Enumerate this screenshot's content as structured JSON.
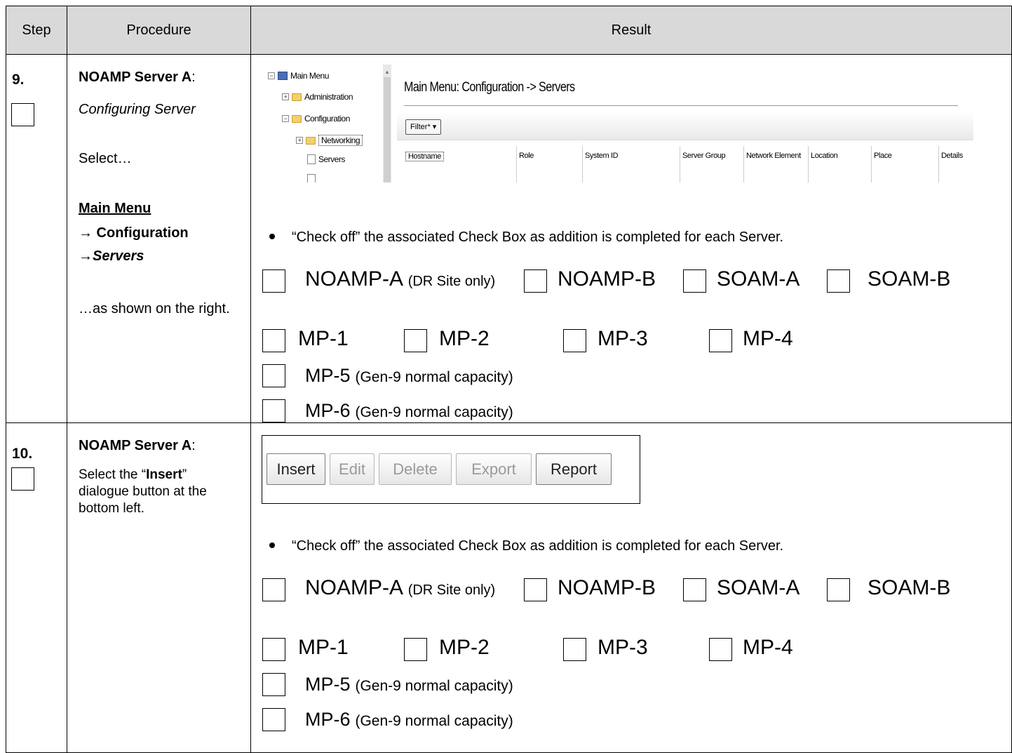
{
  "headers": {
    "step": "Step",
    "procedure": "Procedure",
    "result": "Result"
  },
  "step9": {
    "number": "9.",
    "title": "NOAMP Server A",
    "title_suffix": ":",
    "subtitle": "Configuring Server",
    "select": "Select…",
    "menu1": "Main Menu",
    "menu2": "→ Configuration",
    "menu3": "→Servers",
    "shown": "…as shown on the right.",
    "screenshot": {
      "tree": {
        "main_menu": "Main Menu",
        "administration": "Administration",
        "configuration": "Configuration",
        "networking": "Networking",
        "servers": "Servers"
      },
      "title": "Main Menu: Configuration -> Servers",
      "filter_label": "Filter* ▾",
      "columns": [
        "Hostname",
        "Role",
        "System ID",
        "Server Group",
        "Network Element",
        "Location",
        "Place",
        "Details"
      ]
    }
  },
  "step10": {
    "number": "10.",
    "title": "NOAMP Server A",
    "title_suffix": ":",
    "line1_pre": "Select the “",
    "line1_bold": "Insert",
    "line1_post": "”",
    "line2": "dialogue button at the",
    "line3": "bottom left.",
    "buttons": [
      {
        "label": "Insert",
        "enabled": true
      },
      {
        "label": "Edit",
        "enabled": false
      },
      {
        "label": "Delete",
        "enabled": false
      },
      {
        "label": "Export",
        "enabled": false
      },
      {
        "label": "Report",
        "enabled": true
      }
    ]
  },
  "checklist": {
    "instruction": "“Check off” the associated Check Box as addition is completed for each Server.",
    "noamp_a": "NOAMP-A",
    "noamp_a_note": "(DR Site only)",
    "noamp_b": "NOAMP-B",
    "soam_a": "SOAM-A",
    "soam_b": "SOAM-B",
    "mp1": "MP-1",
    "mp2": "MP-2",
    "mp3": "MP-3",
    "mp4": "MP-4",
    "mp5": "MP-5",
    "mp6": "MP-6",
    "capacity_note": "(Gen-9 normal capacity)"
  }
}
